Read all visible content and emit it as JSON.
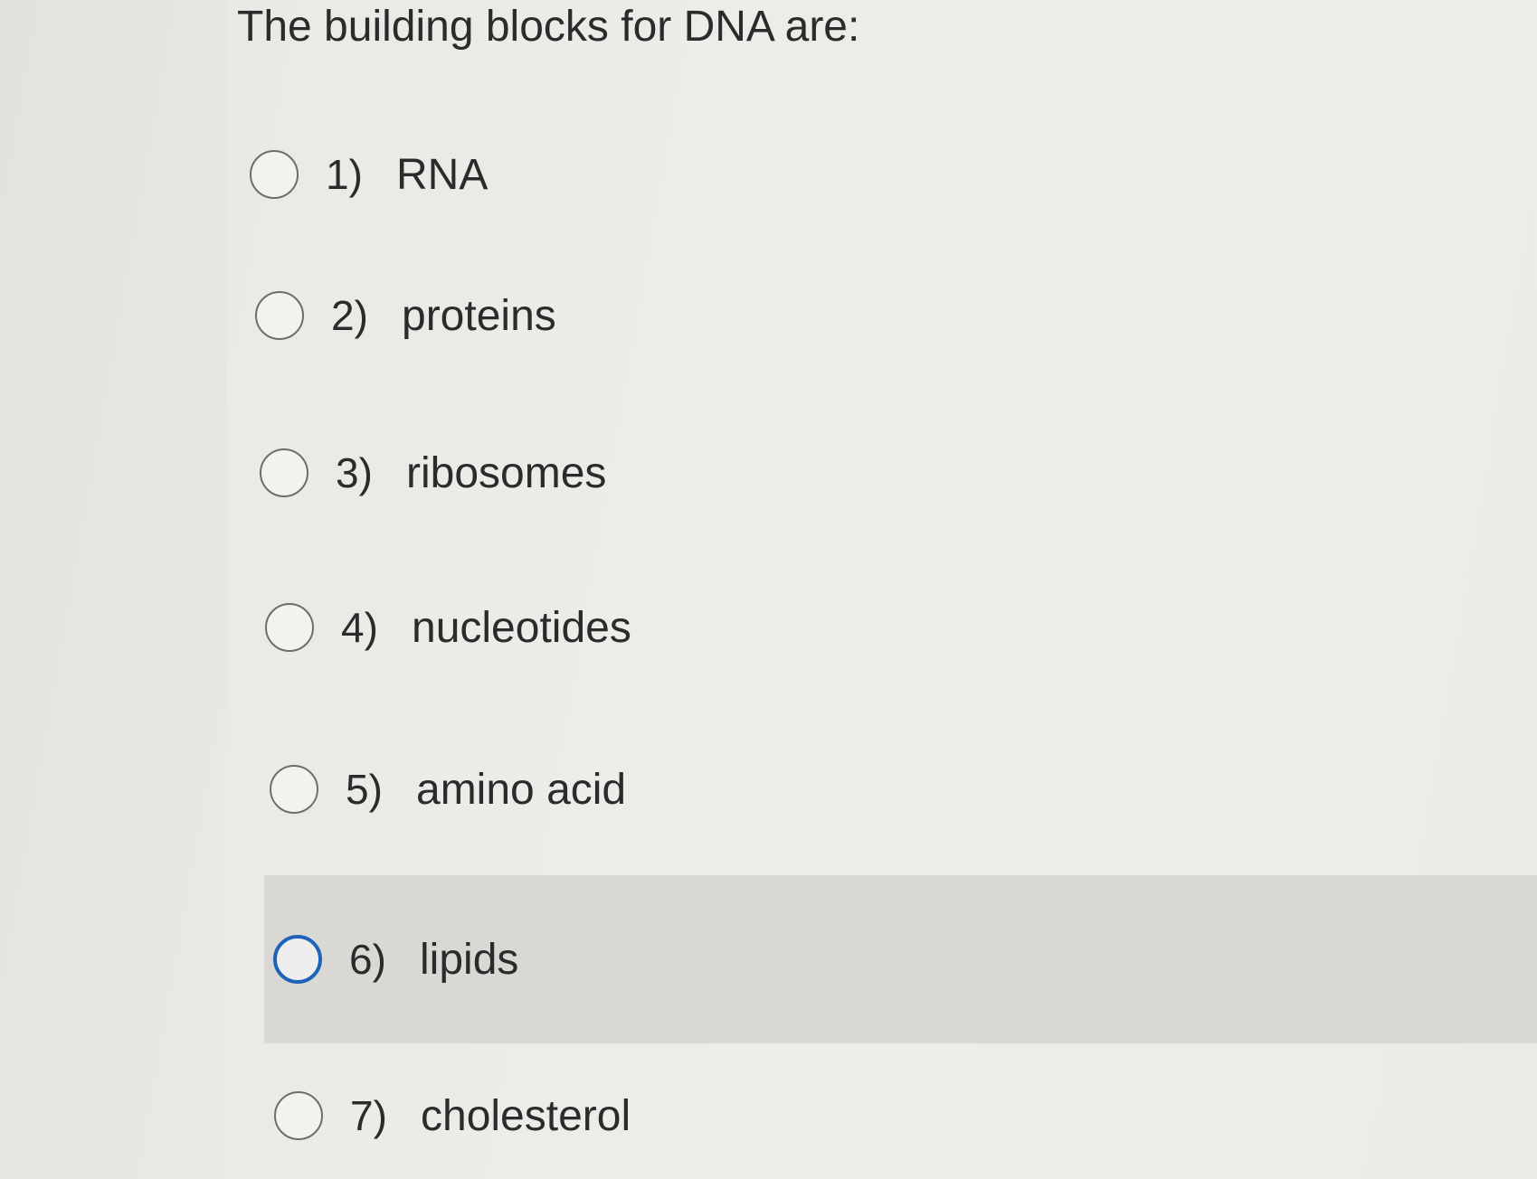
{
  "question": {
    "title": "The building blocks for DNA are:"
  },
  "options": [
    {
      "number": "1)",
      "label": "RNA",
      "selected": false
    },
    {
      "number": "2)",
      "label": "proteins",
      "selected": false
    },
    {
      "number": "3)",
      "label": "ribosomes",
      "selected": false
    },
    {
      "number": "4)",
      "label": "nucleotides",
      "selected": false
    },
    {
      "number": "5)",
      "label": "amino acid",
      "selected": false
    },
    {
      "number": "6)",
      "label": "lipids",
      "selected": true
    },
    {
      "number": "7)",
      "label": "cholesterol",
      "selected": false
    }
  ],
  "colors": {
    "selected_radio": "#1f63b8",
    "selected_row_bg": "#d9d8d4",
    "unselected_radio": "#6d6d6d"
  }
}
